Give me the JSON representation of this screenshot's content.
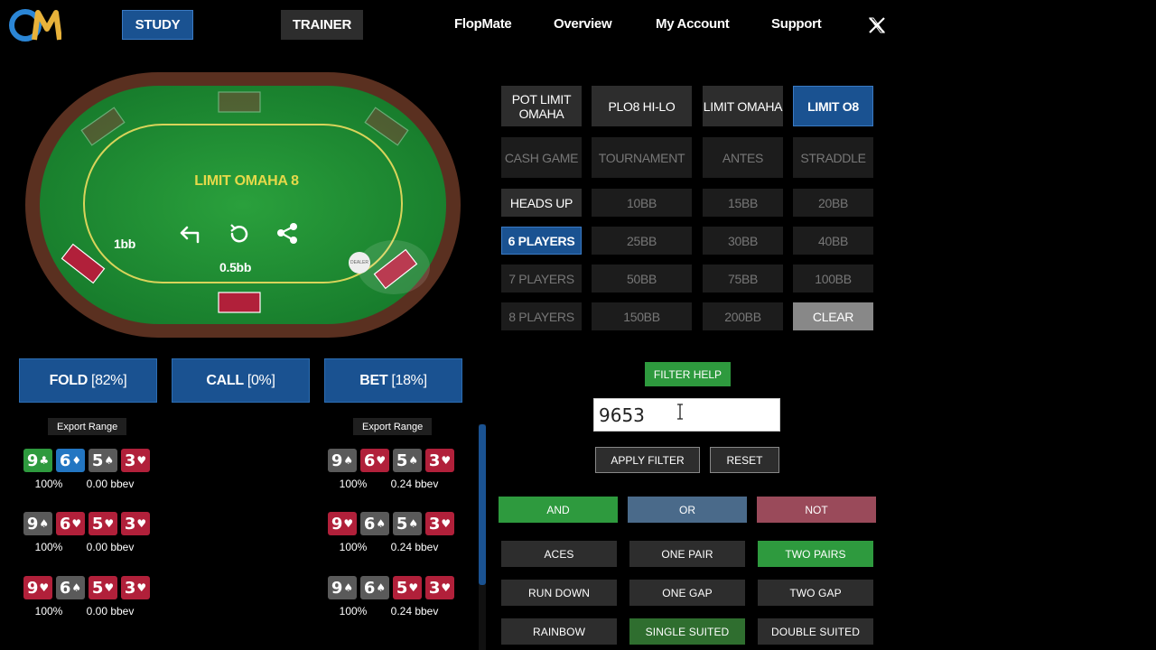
{
  "nav": {
    "study": "STUDY",
    "trainer": "TRAINER",
    "links": [
      "FlopMate",
      "Overview",
      "My Account",
      "Support"
    ]
  },
  "table": {
    "title": "LIMIT OMAHA 8",
    "small_blind": "1bb",
    "big_blind": "0.5bb",
    "dealer": "DEALER"
  },
  "actions": {
    "fold": {
      "label": "FOLD",
      "pct": "[82%]"
    },
    "call": {
      "label": "CALL",
      "pct": "[0%]"
    },
    "bet": {
      "label": "BET",
      "pct": "[18%]"
    }
  },
  "export_label": "Export Range",
  "ranges": {
    "left": [
      {
        "cards": [
          {
            "r": "9",
            "s": "♣",
            "c": "green"
          },
          {
            "r": "6",
            "s": "♦",
            "c": "blue"
          },
          {
            "r": "5",
            "s": "♠",
            "c": "gray"
          },
          {
            "r": "3",
            "s": "♥",
            "c": "red"
          }
        ],
        "freq": "100%",
        "ev": "0.00 bbev"
      },
      {
        "cards": [
          {
            "r": "9",
            "s": "♠",
            "c": "gray"
          },
          {
            "r": "6",
            "s": "♥",
            "c": "red"
          },
          {
            "r": "5",
            "s": "♥",
            "c": "red"
          },
          {
            "r": "3",
            "s": "♥",
            "c": "red"
          }
        ],
        "freq": "100%",
        "ev": "0.00 bbev"
      },
      {
        "cards": [
          {
            "r": "9",
            "s": "♥",
            "c": "red"
          },
          {
            "r": "6",
            "s": "♠",
            "c": "gray"
          },
          {
            "r": "5",
            "s": "♥",
            "c": "red"
          },
          {
            "r": "3",
            "s": "♥",
            "c": "red"
          }
        ],
        "freq": "100%",
        "ev": "0.00 bbev"
      }
    ],
    "right": [
      {
        "cards": [
          {
            "r": "9",
            "s": "♠",
            "c": "gray"
          },
          {
            "r": "6",
            "s": "♥",
            "c": "red"
          },
          {
            "r": "5",
            "s": "♠",
            "c": "gray"
          },
          {
            "r": "3",
            "s": "♥",
            "c": "red"
          }
        ],
        "freq": "100%",
        "ev": "0.24 bbev"
      },
      {
        "cards": [
          {
            "r": "9",
            "s": "♥",
            "c": "red"
          },
          {
            "r": "6",
            "s": "♠",
            "c": "gray"
          },
          {
            "r": "5",
            "s": "♠",
            "c": "gray"
          },
          {
            "r": "3",
            "s": "♥",
            "c": "red"
          }
        ],
        "freq": "100%",
        "ev": "0.24 bbev"
      },
      {
        "cards": [
          {
            "r": "9",
            "s": "♠",
            "c": "gray"
          },
          {
            "r": "6",
            "s": "♠",
            "c": "gray"
          },
          {
            "r": "5",
            "s": "♥",
            "c": "red"
          },
          {
            "r": "3",
            "s": "♥",
            "c": "red"
          }
        ],
        "freq": "100%",
        "ev": "0.24 bbev"
      }
    ]
  },
  "games": [
    "POT LIMIT OMAHA",
    "PLO8 HI-LO",
    "LIMIT OMAHA",
    "LIMIT O8"
  ],
  "formats": [
    "CASH GAME",
    "TOURNAMENT",
    "ANTES",
    "STRADDLE"
  ],
  "players_rows": [
    [
      "HEADS UP",
      "10BB",
      "15BB",
      "20BB"
    ],
    [
      "6 PLAYERS",
      "25BB",
      "30BB",
      "40BB"
    ],
    [
      "7 PLAYERS",
      "50BB",
      "75BB",
      "100BB"
    ],
    [
      "8 PLAYERS",
      "150BB",
      "200BB",
      "CLEAR"
    ]
  ],
  "filter": {
    "help": "FILTER HELP",
    "value": "9653",
    "apply": "APPLY FILTER",
    "reset": "RESET"
  },
  "logic": [
    "AND",
    "OR",
    "NOT"
  ],
  "patterns": [
    [
      "ACES",
      "ONE PAIR",
      "TWO PAIRS"
    ],
    [
      "RUN DOWN",
      "ONE GAP",
      "TWO GAP"
    ],
    [
      "RAINBOW",
      "SINGLE SUITED",
      "DOUBLE SUITED"
    ]
  ],
  "colors": {
    "brand_blue": "#1a5291",
    "green": "#2e9a3e",
    "red": "#b1203a",
    "felt": "#1f8a33",
    "rail": "#5a3020"
  }
}
